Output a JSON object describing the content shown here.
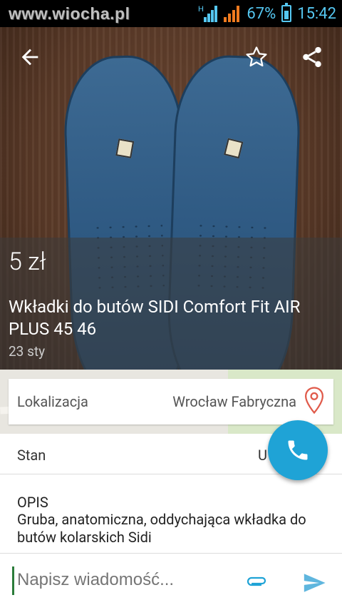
{
  "status_bar": {
    "watermark": "www.wiocha.pl",
    "battery": "67%",
    "time": "15:42",
    "accent": "#55c7f1"
  },
  "listing": {
    "price": "5 zł",
    "title": "Wkładki do butów SIDI Comfort Fit AIR PLUS 45 46",
    "date": "23  sty"
  },
  "location": {
    "label": "Lokalizacja",
    "value": "Wrocław Fabryczna"
  },
  "details": {
    "state_label": "Stan",
    "state_value": "U"
  },
  "description": {
    "header": "OPIS",
    "text": "Gruba, anatomiczna, oddychająca wkładka do butów kolarskich Sidi"
  },
  "composer": {
    "placeholder": "Napisz wiadomość..."
  },
  "icons": [
    "back-arrow-icon",
    "star-icon",
    "share-icon",
    "map-pin-icon",
    "phone-icon",
    "attach-icon",
    "send-icon"
  ],
  "colors": {
    "fab": "#1fa3d6",
    "pin": "#e05a4a"
  }
}
